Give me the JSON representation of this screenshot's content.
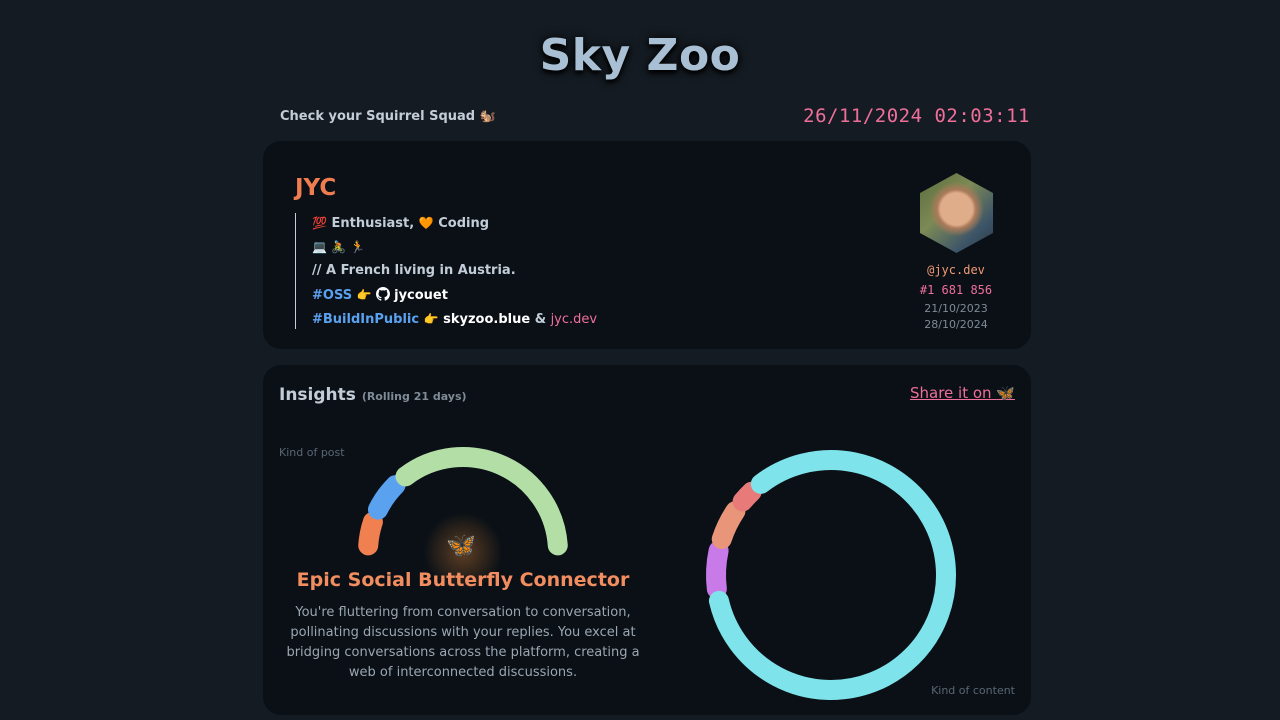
{
  "app": {
    "title": "Sky Zoo",
    "subline": "Check your Squirrel Squad 🐿️",
    "clock": "26/11/2024 02:03:11"
  },
  "profile": {
    "name": "JYC",
    "bio": {
      "line1_a": "💯",
      "line1_b": "Enthusiast,",
      "line1_c": "🧡",
      "line1_d": "Coding",
      "line2": "💻 🚴 🏃",
      "line3": "// A French living in Austria.",
      "line4_tag": "#OSS",
      "line4_point": "👉",
      "line4_github_icon": "github-icon",
      "line4_user": "jycouet",
      "line5_tag": "#BuildInPublic",
      "line5_point": "👉",
      "line5_site": "skyzoo.blue",
      "line5_amp": "&",
      "line5_link": "jyc.dev"
    },
    "handle": "@jyc.dev",
    "rank": "#1 681 856",
    "date_1": "21/10/2023",
    "date_2": "28/10/2024"
  },
  "insights": {
    "title": "Insights",
    "subtitle": "(Rolling 21 days)",
    "share_label": "Share it on",
    "share_icon": "🦋",
    "kind_post_label": "Kind of post",
    "kind_content_label": "Kind of content",
    "persona_icon": "🦋",
    "persona_title": "Epic Social Butterfly Connector",
    "persona_desc": "You're fluttering from conversation to conversation, pollinating discussions with your replies. You excel at bridging conversations across the platform, creating a web of interconnected discussions."
  },
  "colors": {
    "background": "#141b22",
    "card": "#0a1016",
    "accent_orange": "#f07d4f",
    "accent_pink": "#ef6f9a",
    "link_blue": "#5aa2f0"
  },
  "chart_data": [
    {
      "type": "pie",
      "variant": "half-donut",
      "values": [
        6,
        7,
        35
      ],
      "colors": [
        "#f08050",
        "#5aa2f0",
        "#b3dfa6"
      ]
    },
    {
      "type": "pie",
      "variant": "donut",
      "values": [
        7,
        6,
        3.5,
        83.5
      ],
      "colors": [
        "#c87ae8",
        "#e8957a",
        "#e87a7a",
        "#7ee3ea"
      ]
    }
  ]
}
